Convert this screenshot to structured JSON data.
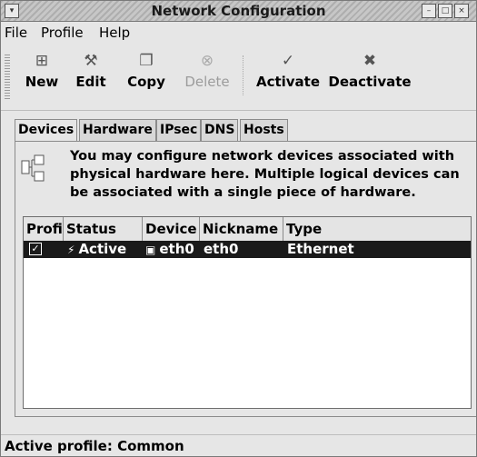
{
  "window": {
    "title": "Network Configuration"
  },
  "menu": {
    "file": "File",
    "profile": "Profile",
    "help": "Help"
  },
  "toolbar": {
    "new": "New",
    "edit": "Edit",
    "copy": "Copy",
    "delete": "Delete",
    "activate": "Activate",
    "deactivate": "Deactivate"
  },
  "tabs": [
    {
      "label": "Devices",
      "active": true
    },
    {
      "label": "Hardware"
    },
    {
      "label": "IPsec"
    },
    {
      "label": "DNS"
    },
    {
      "label": "Hosts"
    }
  ],
  "info": {
    "text": "You may configure network devices associated with physical hardware here.  Multiple logical devices can be associated with a single piece of hardware."
  },
  "table": {
    "columns": [
      "Profi",
      "Status",
      "Device",
      "Nickname",
      "Type"
    ],
    "rows": [
      {
        "profile_checked": true,
        "status": "Active",
        "device": "eth0",
        "nickname": "eth0",
        "type": "Ethernet"
      }
    ]
  },
  "status": {
    "text": "Active profile: Common"
  },
  "icons": {
    "window_menu": "chevron-down-icon",
    "minimize": "minimize-icon",
    "maximize": "maximize-icon",
    "close": "close-icon",
    "new": "new-document-icon",
    "edit": "wrench-icon",
    "copy": "copy-icon",
    "delete": "trash-icon",
    "activate": "check-icon",
    "deactivate": "x-icon",
    "hardware_tree": "device-tree-icon",
    "status_active": "plug-icon",
    "device": "network-card-icon"
  }
}
